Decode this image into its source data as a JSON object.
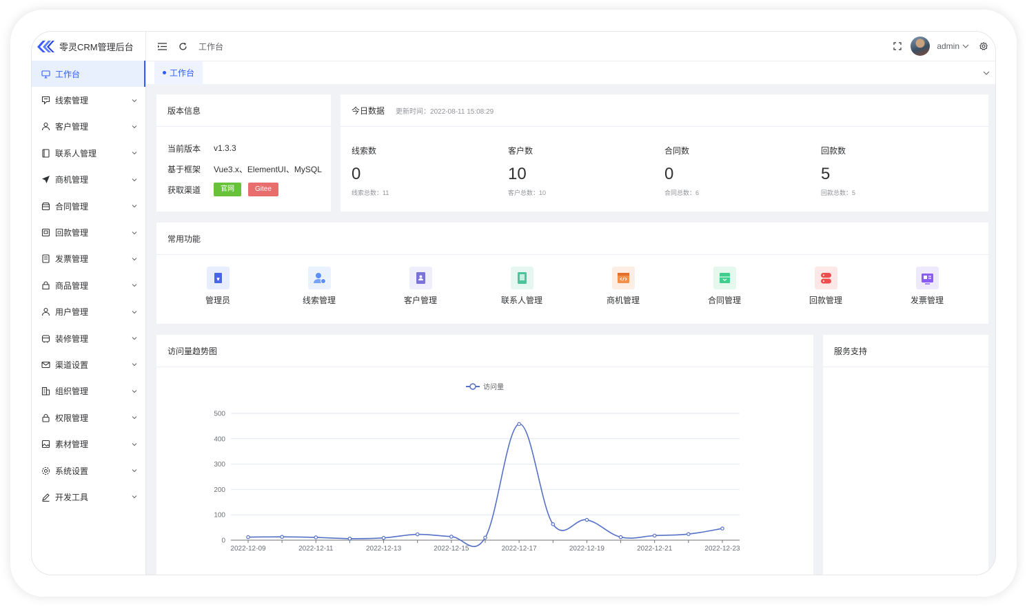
{
  "app": {
    "title": "零灵CRM管理后台"
  },
  "sidebar": {
    "items": [
      {
        "label": "工作台",
        "icon": "monitor-icon",
        "active": true
      },
      {
        "label": "线索管理",
        "icon": "clue-icon"
      },
      {
        "label": "客户管理",
        "icon": "user-icon"
      },
      {
        "label": "联系人管理",
        "icon": "contact-book-icon"
      },
      {
        "label": "商机管理",
        "icon": "send-icon"
      },
      {
        "label": "合同管理",
        "icon": "box-icon"
      },
      {
        "label": "回款管理",
        "icon": "payment-icon"
      },
      {
        "label": "发票管理",
        "icon": "invoice-icon"
      },
      {
        "label": "商品管理",
        "icon": "goods-icon"
      },
      {
        "label": "用户管理",
        "icon": "user-icon"
      },
      {
        "label": "装修管理",
        "icon": "decorate-icon"
      },
      {
        "label": "渠道设置",
        "icon": "mail-icon"
      },
      {
        "label": "组织管理",
        "icon": "building-icon"
      },
      {
        "label": "权限管理",
        "icon": "lock-icon"
      },
      {
        "label": "素材管理",
        "icon": "image-icon"
      },
      {
        "label": "系统设置",
        "icon": "gear-icon"
      },
      {
        "label": "开发工具",
        "icon": "pen-icon"
      }
    ]
  },
  "header": {
    "breadcrumb": "工作台",
    "username": "admin"
  },
  "tabs": [
    {
      "label": "工作台"
    }
  ],
  "version": {
    "title": "版本信息",
    "rows": [
      {
        "key": "当前版本",
        "value": "v1.3.3"
      },
      {
        "key": "基于框架",
        "value": "Vue3.x、ElementUI、MySQL"
      }
    ],
    "channel_key": "获取渠道",
    "btn_official": "官网",
    "btn_gitee": "Gitee"
  },
  "today": {
    "title": "今日数据",
    "update_time": "更新时间：2022-08-11 15:08:29",
    "stats": [
      {
        "label": "线索数",
        "value": "0",
        "total": "线索总数：11"
      },
      {
        "label": "客户数",
        "value": "10",
        "total": "客户总数：10"
      },
      {
        "label": "合同数",
        "value": "0",
        "total": "合同总数：6"
      },
      {
        "label": "回款数",
        "value": "5",
        "total": "回款总数：5"
      }
    ]
  },
  "functions": {
    "title": "常用功能",
    "items": [
      {
        "label": "管理员",
        "icon": "admin-icon",
        "color": "#4a66e8",
        "bg": "#e8edff"
      },
      {
        "label": "线索管理",
        "icon": "clue-user-icon",
        "color": "#5b8ff9",
        "bg": "#eaf2ff"
      },
      {
        "label": "客户管理",
        "icon": "customer-book-icon",
        "color": "#7b74d8",
        "bg": "#efeefc"
      },
      {
        "label": "联系人管理",
        "icon": "contact-icon",
        "color": "#4cc49b",
        "bg": "#e6f7f1"
      },
      {
        "label": "商机管理",
        "icon": "code-window-icon",
        "color": "#f28f4b",
        "bg": "#fdeee3"
      },
      {
        "label": "合同管理",
        "icon": "inbox-icon",
        "color": "#3ecf8e",
        "bg": "#e4f8ee"
      },
      {
        "label": "回款管理",
        "icon": "server-icon",
        "color": "#ee4d4d",
        "bg": "#fde7e7"
      },
      {
        "label": "发票管理",
        "icon": "invoice-card-icon",
        "color": "#8a5cf6",
        "bg": "#efe9fe"
      }
    ]
  },
  "trend": {
    "title": "访问量趋势图"
  },
  "service": {
    "title": "服务支持"
  },
  "colors": {
    "accent": "#2d5bff",
    "line": "#5470c6"
  },
  "chart_data": {
    "type": "line",
    "legend": [
      "访问量"
    ],
    "x": [
      "2022-12-09",
      "2022-12-10",
      "2022-12-11",
      "2022-12-12",
      "2022-12-13",
      "2022-12-14",
      "2022-12-15",
      "2022-12-16",
      "2022-12-17",
      "2022-12-18",
      "2022-12-19",
      "2022-12-20",
      "2022-12-21",
      "2022-12-22",
      "2022-12-23"
    ],
    "x_tick_labels": [
      "2022-12-09",
      "2022-12-11",
      "2022-12-13",
      "2022-12-15",
      "2022-12-17",
      "2022-12-19",
      "2022-12-21",
      "2022-12-23"
    ],
    "series": [
      {
        "name": "访问量",
        "values": [
          12,
          13,
          11,
          6,
          9,
          23,
          14,
          10,
          458,
          63,
          80,
          12,
          18,
          24,
          46
        ]
      }
    ],
    "ylim": [
      0,
      500
    ],
    "y_ticks": [
      0,
      100,
      200,
      300,
      400,
      500
    ],
    "grid": true,
    "legend_position": "top-center"
  }
}
